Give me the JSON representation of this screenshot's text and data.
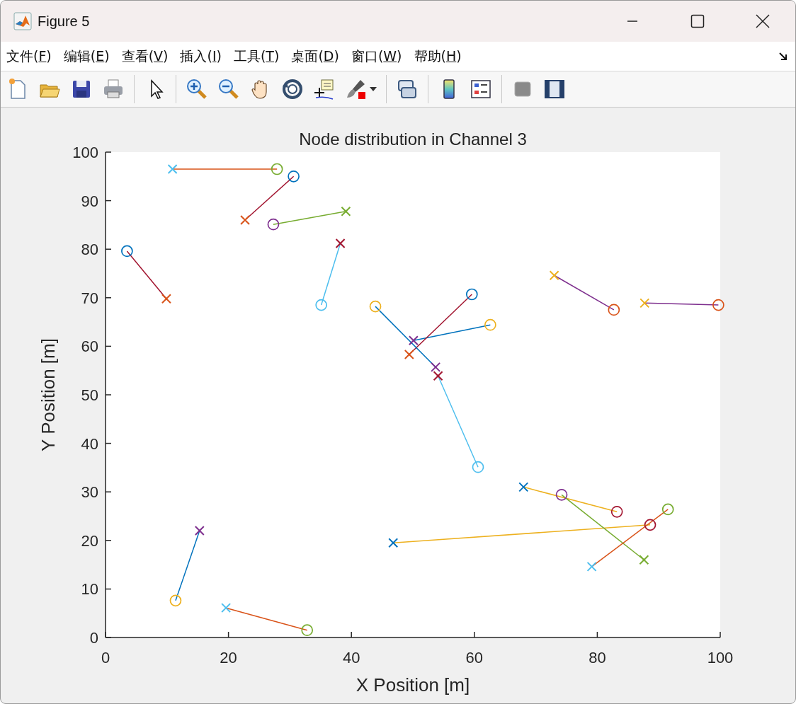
{
  "window": {
    "title": "Figure 5"
  },
  "menu": [
    {
      "before": "文件(",
      "key": "F",
      "after": ")"
    },
    {
      "before": "编辑(",
      "key": "E",
      "after": ")"
    },
    {
      "before": "查看(",
      "key": "V",
      "after": ")"
    },
    {
      "before": "插入(",
      "key": "I",
      "after": ")"
    },
    {
      "before": "工具(",
      "key": "T",
      "after": ")"
    },
    {
      "before": "桌面(",
      "key": "D",
      "after": ")"
    },
    {
      "before": "窗口(",
      "key": "W",
      "after": ")"
    },
    {
      "before": "帮助(",
      "key": "H",
      "after": ")"
    }
  ],
  "chart_data": {
    "type": "line",
    "title": "Node distribution in Channel 3",
    "xlabel": "X Position [m]",
    "ylabel": "Y Position [m]",
    "xlim": [
      0,
      100
    ],
    "ylim": [
      0,
      100
    ],
    "xticks": [
      0,
      20,
      40,
      60,
      80,
      100
    ],
    "yticks": [
      0,
      10,
      20,
      30,
      40,
      50,
      60,
      70,
      80,
      90,
      100
    ],
    "series": [
      {
        "color": "#d95319",
        "marker": "cross",
        "x": [
          10.9,
          27.9
        ],
        "values": [
          96.5,
          96.5
        ]
      },
      {
        "color": "#a2142f",
        "marker": "cross",
        "x": [
          22.7,
          30.6
        ],
        "values": [
          86.0,
          95.0
        ]
      },
      {
        "color": "#77ac30",
        "marker": "cross",
        "x": [
          39.1,
          27.3
        ],
        "values": [
          87.8,
          85.1
        ]
      },
      {
        "color": "#a2142f",
        "marker": "cross",
        "x": [
          9.9,
          3.5
        ],
        "values": [
          69.8,
          79.6
        ]
      },
      {
        "color": "#4dbeee",
        "marker": "cross",
        "x": [
          38.2,
          35.1
        ],
        "values": [
          81.2,
          68.5
        ]
      },
      {
        "color": "#0072bd",
        "marker": "cross",
        "x": [
          50.1,
          62.6
        ],
        "values": [
          61.2,
          64.4
        ]
      },
      {
        "color": "#a2142f",
        "marker": "cross",
        "x": [
          49.4,
          59.6
        ],
        "values": [
          58.3,
          70.7
        ]
      },
      {
        "color": "#0072bd",
        "marker": "cross",
        "x": [
          53.7,
          43.9
        ],
        "values": [
          55.7,
          68.2
        ]
      },
      {
        "color": "#4dbeee",
        "marker": "cross",
        "x": [
          54.1,
          60.6
        ],
        "values": [
          53.9,
          35.1
        ]
      },
      {
        "color": "#7e2f8e",
        "marker": "cross",
        "x": [
          73.0,
          82.7
        ],
        "values": [
          74.6,
          67.5
        ]
      },
      {
        "color": "#7e2f8e",
        "marker": "cross",
        "x": [
          87.7,
          99.7
        ],
        "values": [
          68.9,
          68.5
        ]
      },
      {
        "color": "#0072bd",
        "marker": "cross",
        "x": [
          15.3,
          11.4
        ],
        "values": [
          22.0,
          7.6
        ]
      },
      {
        "color": "#d95319",
        "marker": "cross",
        "x": [
          19.6,
          32.8
        ],
        "values": [
          6.1,
          1.5
        ]
      },
      {
        "color": "#edb120",
        "marker": "cross",
        "x": [
          68.0,
          83.2
        ],
        "values": [
          31.0,
          25.9
        ]
      },
      {
        "color": "#edb120",
        "marker": "cross",
        "x": [
          46.8,
          88.6
        ],
        "values": [
          19.5,
          23.2
        ]
      },
      {
        "color": "#77ac30",
        "marker": "cross",
        "x": [
          87.6,
          74.2
        ],
        "values": [
          16.0,
          29.4
        ]
      },
      {
        "color": "#d95319",
        "marker": "cross",
        "x": [
          79.1,
          91.5
        ],
        "values": [
          14.6,
          26.4
        ]
      }
    ]
  },
  "link_markers": [
    {
      "start": {
        "color": "#4dbeee"
      },
      "end": {
        "kind": "circle",
        "color": "#77ac30"
      }
    },
    {
      "start": {
        "color": "#d95319"
      },
      "end": {
        "kind": "circle",
        "color": "#0072bd"
      }
    },
    {
      "start": {
        "color": "#77ac30"
      },
      "end": {
        "kind": "circle",
        "color": "#7e2f8e"
      }
    },
    {
      "start": {
        "color": "#d95319"
      },
      "end": {
        "kind": "circle",
        "color": "#0072bd"
      }
    },
    {
      "start": {
        "color": "#a2142f"
      },
      "end": {
        "kind": "circle",
        "color": "#4dbeee"
      }
    },
    {
      "start": {
        "color": "#7e2f8e"
      },
      "end": {
        "kind": "circle",
        "color": "#edb120"
      }
    },
    {
      "start": {
        "color": "#d95319"
      },
      "end": {
        "kind": "circle",
        "color": "#0072bd"
      }
    },
    {
      "start": {
        "color": "#7e2f8e"
      },
      "end": {
        "kind": "circle",
        "color": "#edb120"
      }
    },
    {
      "start": {
        "color": "#a2142f"
      },
      "end": {
        "kind": "circle",
        "color": "#4dbeee"
      }
    },
    {
      "start": {
        "color": "#edb120"
      },
      "end": {
        "kind": "circle",
        "color": "#d95319"
      }
    },
    {
      "start": {
        "color": "#edb120"
      },
      "end": {
        "kind": "circle",
        "color": "#d95319"
      }
    },
    {
      "start": {
        "color": "#7e2f8e"
      },
      "end": {
        "kind": "circle",
        "color": "#edb120"
      }
    },
    {
      "start": {
        "color": "#4dbeee"
      },
      "end": {
        "kind": "circle",
        "color": "#77ac30"
      }
    },
    {
      "start": {
        "color": "#0072bd"
      },
      "end": {
        "kind": "circle",
        "color": "#a2142f"
      }
    },
    {
      "start": {
        "color": "#0072bd"
      },
      "end": {
        "kind": "circle",
        "color": "#a2142f"
      }
    },
    {
      "start": {
        "color": "#77ac30"
      },
      "end": {
        "kind": "circle",
        "color": "#7e2f8e"
      }
    },
    {
      "start": {
        "color": "#4dbeee"
      },
      "end": {
        "kind": "circle",
        "color": "#77ac30"
      }
    }
  ]
}
